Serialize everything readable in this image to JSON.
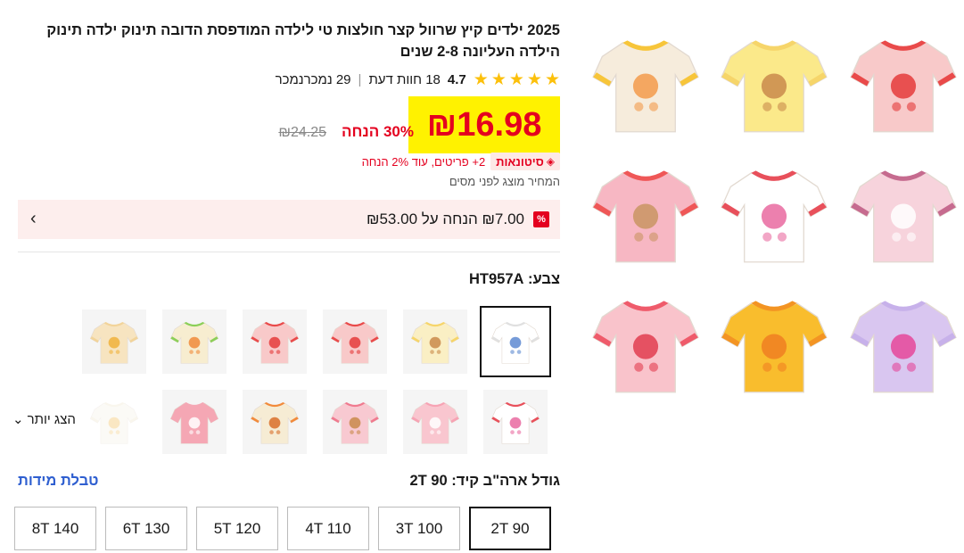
{
  "product": {
    "title": "2025 ילדים קיץ שרוול קצר חולצות טי לילדה המודפסת הדובה תינוק ילדה תינוק הילדה העליונה 2-8 שנים",
    "rating": "4.7",
    "star_count": 5,
    "reviews": "18 חוות דעת",
    "sold": "29 נמכרנמכר"
  },
  "price": {
    "current": "₪16.98",
    "discount": "30% הנחה",
    "original": "₪24.25",
    "wholesale_badge": "סיטונאות",
    "wholesale_text": "2+ פריטים, עוד 2% הנחה",
    "tax_note": "המחיר מוצג לפני מסים"
  },
  "coupon": {
    "badge": "%",
    "text": "₪7.00 הנחה על ₪53.00"
  },
  "color": {
    "label": "צבע:",
    "selected": "HT957A",
    "show_more": "הצג יותר"
  },
  "size": {
    "label": "גודל ארה\"ב קיד:",
    "selected": "2T 90",
    "chart_link": "טבלת מידות",
    "options": [
      "2T 90",
      "3T 100",
      "4T 110",
      "5T 120",
      "6T 130",
      "8T 140"
    ]
  },
  "gallery_colors": [
    {
      "body": "#f6ecdc",
      "collar": "#f7c53a",
      "motif": "#f39b4b"
    },
    {
      "body": "#fbe98a",
      "collar": "#f6d56a",
      "motif": "#c98a4b"
    },
    {
      "body": "#f8c9c9",
      "collar": "#e94a4a",
      "motif": "#e53b3b"
    },
    {
      "body": "#f7b7c3",
      "collar": "#ef5757",
      "motif": "#c99563"
    },
    {
      "body": "#ffffff",
      "collar": "#e8505b",
      "motif": "#e96aa0"
    },
    {
      "body": "#f7d3dc",
      "collar": "#c66b8f",
      "motif": "#ffffff"
    },
    {
      "body": "#f9c3cb",
      "collar": "#ef5b6b",
      "motif": "#e23d50"
    },
    {
      "body": "#f9bd2d",
      "collar": "#f39423",
      "motif": "#f07f22"
    },
    {
      "body": "#d9c6f0",
      "collar": "#c7b1ea",
      "motif": "#e5469a"
    }
  ],
  "thumb_colors_row1": [
    {
      "body": "#ffffff",
      "collar": "#e0e0e0",
      "motif": "#5e8ad1"
    },
    {
      "body": "#faefc4",
      "collar": "#f6d56a",
      "motif": "#c98a4b"
    },
    {
      "body": "#f8c9c9",
      "collar": "#e94a4a",
      "motif": "#e53b3b"
    },
    {
      "body": "#f8c9c9",
      "collar": "#e94a4a",
      "motif": "#e53b3b"
    },
    {
      "body": "#f7edd0",
      "collar": "#8bcf58",
      "motif": "#f08a3b"
    },
    {
      "body": "#f7e4c0",
      "collar": "#f2d49a",
      "motif": "#f0b23b"
    }
  ],
  "thumb_colors_row2": [
    {
      "body": "#ffffff",
      "collar": "#e8505b",
      "motif": "#e96aa0"
    },
    {
      "body": "#f9c6cf",
      "collar": "#f7a3b4",
      "motif": "#ffffff"
    },
    {
      "body": "#f8c9d1",
      "collar": "#f07a8f",
      "motif": "#c98a4b"
    },
    {
      "body": "#f6ecd4",
      "collar": "#f28a3b",
      "motif": "#d9702a"
    },
    {
      "body": "#f5a7b4",
      "collar": "#f5a7b4",
      "motif": "#ffffff"
    },
    {
      "body": "#f6f2e6",
      "collar": "#f0e6cc",
      "motif": "#f0b23b"
    }
  ]
}
